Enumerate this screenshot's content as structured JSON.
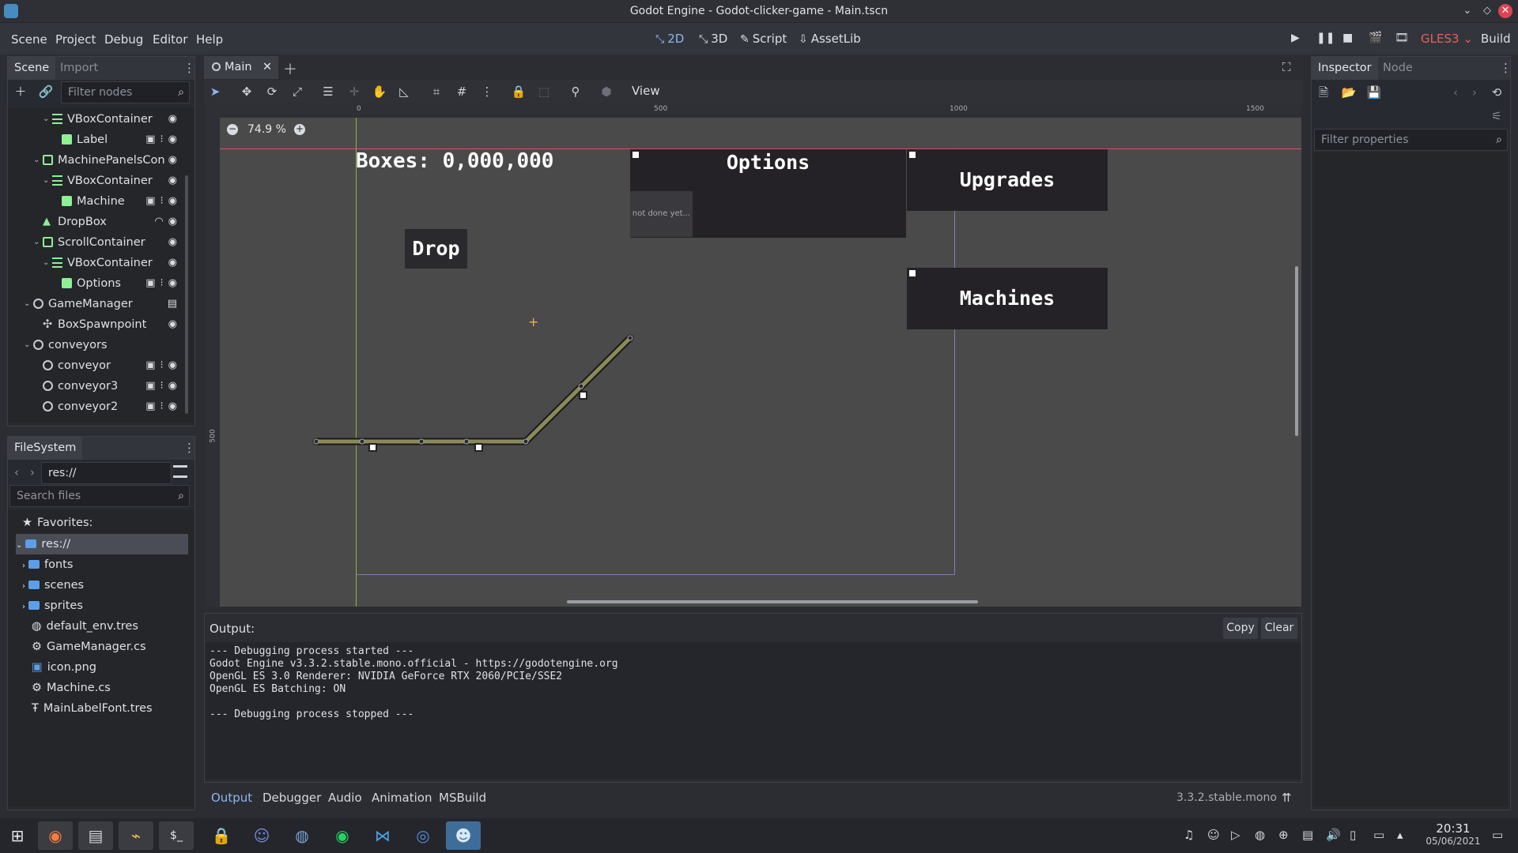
{
  "window": {
    "title": "Godot Engine - Godot-clicker-game - Main.tscn"
  },
  "menu": [
    "Scene",
    "Project",
    "Debug",
    "Editor",
    "Help"
  ],
  "workspaces": [
    {
      "label": "2D",
      "icon": "2d-icon"
    },
    {
      "label": "3D",
      "icon": "3d-icon"
    },
    {
      "label": "Script",
      "icon": "script-icon"
    },
    {
      "label": "AssetLib",
      "icon": "assetlib-icon"
    }
  ],
  "renderer": "GLES3",
  "build_label": "Build",
  "scene_dock": {
    "tabs": [
      "Scene",
      "Import"
    ],
    "filter_placeholder": "Filter nodes",
    "nodes": [
      {
        "label": "VBoxContainer",
        "icon": "vbox-icon"
      },
      {
        "label": "Label",
        "icon": "label-icon"
      },
      {
        "label": "MachinePanelsCon",
        "icon": "container-icon"
      },
      {
        "label": "VBoxContainer",
        "icon": "vbox-icon"
      },
      {
        "label": "Machine",
        "icon": "control-icon"
      },
      {
        "label": "DropBox",
        "icon": "area-icon"
      },
      {
        "label": "ScrollContainer",
        "icon": "container-icon"
      },
      {
        "label": "VBoxContainer",
        "icon": "vbox-icon"
      },
      {
        "label": "Options",
        "icon": "control-icon"
      },
      {
        "label": "GameManager",
        "icon": "node-icon"
      },
      {
        "label": "BoxSpawnpoint",
        "icon": "position-icon"
      },
      {
        "label": "conveyors",
        "icon": "node-icon"
      },
      {
        "label": "conveyor",
        "icon": "node-icon"
      },
      {
        "label": "conveyor3",
        "icon": "node-icon"
      },
      {
        "label": "conveyor2",
        "icon": "node-icon"
      }
    ]
  },
  "filesystem": {
    "title": "FileSystem",
    "path": "res://",
    "search_placeholder": "Search files",
    "favorites": "Favorites:",
    "items": [
      {
        "label": "res://",
        "type": "folder"
      },
      {
        "label": "fonts",
        "type": "folder"
      },
      {
        "label": "scenes",
        "type": "folder"
      },
      {
        "label": "sprites",
        "type": "folder"
      },
      {
        "label": "default_env.tres",
        "type": "env"
      },
      {
        "label": "GameManager.cs",
        "type": "script"
      },
      {
        "label": "icon.png",
        "type": "image"
      },
      {
        "label": "Machine.cs",
        "type": "script"
      },
      {
        "label": "MainLabelFont.tres",
        "type": "font"
      }
    ]
  },
  "editor": {
    "scene_tab": "Main",
    "view_menu": "View",
    "zoom": "74.9 %",
    "ruler_marks": [
      "0",
      "500",
      "1000",
      "1500"
    ],
    "ruler_v_mark": "500"
  },
  "game": {
    "boxes_label": "Boxes: 0,000,000",
    "drop_label": "Drop",
    "options_label": "Options",
    "not_done_label": "not done yet...",
    "upgrades_label": "Upgrades",
    "machines_label": "Machines"
  },
  "output": {
    "title": "Output:",
    "copy": "Copy",
    "clear": "Clear",
    "log": "--- Debugging process started ---\nGodot Engine v3.3.2.stable.mono.official - https://godotengine.org\nOpenGL ES 3.0 Renderer: NVIDIA GeForce RTX 2060/PCIe/SSE2\nOpenGL ES Batching: ON\n\n--- Debugging process stopped ---"
  },
  "bottom_tabs": [
    "Output",
    "Debugger",
    "Audio",
    "Animation",
    "MSBuild"
  ],
  "version": "3.3.2.stable.mono",
  "inspector": {
    "tabs": [
      "Inspector",
      "Node"
    ],
    "filter_placeholder": "Filter properties"
  },
  "taskbar": {
    "time": "20:31",
    "date": "05/06/2021"
  },
  "colors": {
    "accent": "#8fb6ec",
    "node_green": "#8eef97",
    "renderer": "#e85f5f"
  }
}
